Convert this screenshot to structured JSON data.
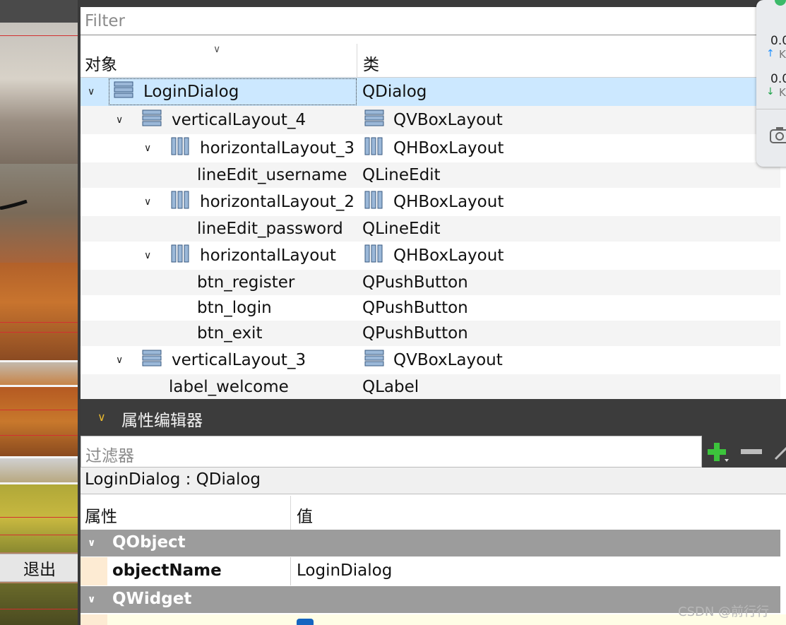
{
  "left_preview": {
    "exit_button_label": "退出"
  },
  "object_inspector": {
    "filter_placeholder": "Filter",
    "columns": {
      "object": "对象",
      "class": "类"
    },
    "rows": [
      {
        "name": "LoginDialog",
        "class": "QDialog",
        "icon": "vertical-layout-icon",
        "class_icon": "",
        "expanded": true,
        "selected": true
      },
      {
        "name": "verticalLayout_4",
        "class": "QVBoxLayout",
        "icon": "vertical-layout-icon",
        "class_icon": "vertical-layout-icon",
        "expanded": true
      },
      {
        "name": "horizontalLayout_3",
        "class": "QHBoxLayout",
        "icon": "horizontal-layout-icon",
        "class_icon": "horizontal-layout-icon",
        "expanded": true
      },
      {
        "name": "lineEdit_username",
        "class": "QLineEdit",
        "icon": "",
        "class_icon": ""
      },
      {
        "name": "horizontalLayout_2",
        "class": "QHBoxLayout",
        "icon": "horizontal-layout-icon",
        "class_icon": "horizontal-layout-icon",
        "expanded": true
      },
      {
        "name": "lineEdit_password",
        "class": "QLineEdit",
        "icon": "",
        "class_icon": ""
      },
      {
        "name": "horizontalLayout",
        "class": "QHBoxLayout",
        "icon": "horizontal-layout-icon",
        "class_icon": "horizontal-layout-icon",
        "expanded": true
      },
      {
        "name": "btn_register",
        "class": "QPushButton",
        "icon": "",
        "class_icon": ""
      },
      {
        "name": "btn_login",
        "class": "QPushButton",
        "icon": "",
        "class_icon": ""
      },
      {
        "name": "btn_exit",
        "class": "QPushButton",
        "icon": "",
        "class_icon": ""
      },
      {
        "name": "verticalLayout_3",
        "class": "QVBoxLayout",
        "icon": "vertical-layout-icon",
        "class_icon": "vertical-layout-icon",
        "expanded": true
      },
      {
        "name": "label_welcome",
        "class": "QLabel",
        "icon": "",
        "class_icon": ""
      }
    ]
  },
  "floating_widget": {
    "upload_value": "0.0",
    "upload_unit": "K",
    "download_value": "0.0",
    "download_unit": "K"
  },
  "property_editor": {
    "title": "属性编辑器",
    "filter_placeholder": "过滤器",
    "object_line": "LoginDialog : QDialog",
    "columns": {
      "property": "属性",
      "value": "值"
    },
    "groups": [
      {
        "name": "QObject",
        "properties": [
          {
            "name": "objectName",
            "value": "LoginDialog"
          }
        ]
      },
      {
        "name": "QWidget",
        "properties": []
      }
    ]
  },
  "watermark": "CSDN @前行行",
  "colors": {
    "selection": "#cce8ff",
    "group_header": "#9c9c9c",
    "dark_panel": "#3c3c3c",
    "accent_chevron": "#e8b830",
    "add_icon": "#3cc43c"
  }
}
